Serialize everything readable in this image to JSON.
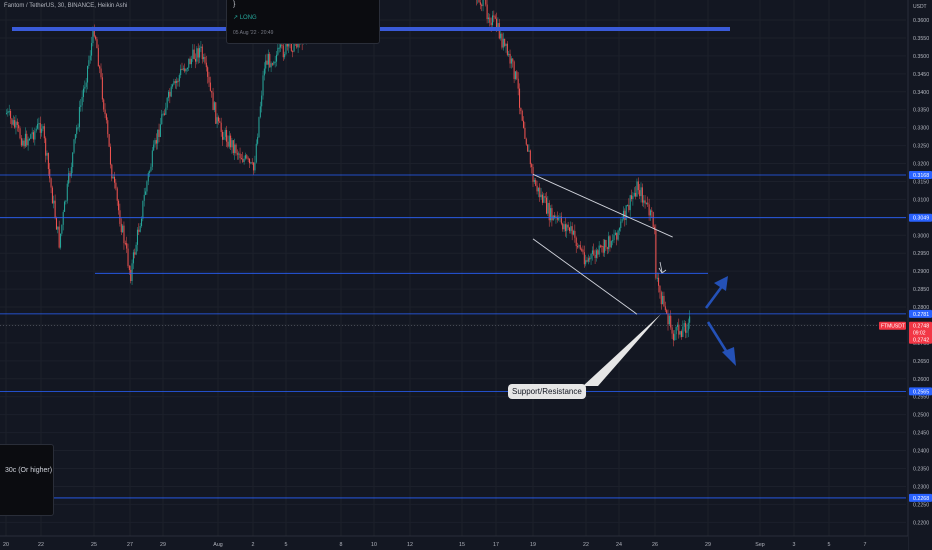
{
  "header": {
    "symbol_title": "Fantom / TetherUS, 30, BINANCE, Heikin Ashi"
  },
  "trade_popup": {
    "line1": "}",
    "line2": "↗ LONG",
    "line3": "05 Aug '22 · 20:49"
  },
  "side_note": {
    "text": "30c (Or higher)"
  },
  "callout": {
    "text": "Support/Resistance"
  },
  "price_axis": {
    "currency": "USDT",
    "ticks": [
      "0.3600",
      "0.3550",
      "0.3500",
      "0.3450",
      "0.3400",
      "0.3350",
      "0.3300",
      "0.3250",
      "0.3200",
      "0.3150",
      "0.3100",
      "0.3050",
      "0.3000",
      "0.2950",
      "0.2900",
      "0.2850",
      "0.2800",
      "0.2750",
      "0.2700",
      "0.2650",
      "0.2600",
      "0.2550",
      "0.2500",
      "0.2450",
      "0.2400",
      "0.2350",
      "0.2300",
      "0.2250",
      "0.2200"
    ]
  },
  "price_tags": [
    {
      "label": "0.3168",
      "color": "#2962ff"
    },
    {
      "label": "0.3049",
      "color": "#2962ff"
    },
    {
      "label": "0.2781",
      "color": "#2962ff"
    },
    {
      "label": "0.2565",
      "color": "#2962ff"
    },
    {
      "label": "0.2268",
      "color": "#2962ff"
    }
  ],
  "current_price": {
    "symbol": "FTMUSDT",
    "price": "0.2748",
    "countdown": "09:02",
    "open": "0.2742",
    "color": "#f23645"
  },
  "time_axis": {
    "labels": [
      "20",
      "22",
      "25",
      "27",
      "29",
      "Aug",
      "2",
      "5",
      "8",
      "10",
      "12",
      "15",
      "17",
      "19",
      "22",
      "24",
      "26",
      "29",
      "Sep",
      "3",
      "5",
      "7"
    ]
  },
  "colors": {
    "background": "#131722",
    "up": "#26a69a",
    "down": "#ef5350",
    "level_line": "#2962ff",
    "thick_level": "#3a5bd9",
    "arrow": "#2451b7",
    "trendline": "#d1d4dc"
  },
  "chart_data": {
    "type": "candlestick",
    "title": "Fantom / TetherUS, 30, BINANCE, Heikin Ashi",
    "xlabel": "",
    "ylabel": "",
    "ylim": [
      0.218,
      0.362
    ],
    "y_scale": "linear",
    "grid": true,
    "timeframe": "30m",
    "chart_style": "Heikin Ashi",
    "x_ticks": [
      "20",
      "22",
      "25",
      "27",
      "29",
      "Aug",
      "2",
      "5",
      "8",
      "10",
      "12",
      "15",
      "17",
      "19",
      "22",
      "24",
      "26",
      "29",
      "Sep",
      "3",
      "5",
      "7"
    ],
    "price_path": [
      {
        "date": "Jul 20",
        "price": 0.334
      },
      {
        "date": "Jul 21",
        "price": 0.326
      },
      {
        "date": "Jul 22",
        "price": 0.331
      },
      {
        "date": "Jul 23",
        "price": 0.298
      },
      {
        "date": "Jul 24",
        "price": 0.33
      },
      {
        "date": "Jul 25",
        "price": 0.358
      },
      {
        "date": "Jul 26",
        "price": 0.316
      },
      {
        "date": "Jul 27",
        "price": 0.289
      },
      {
        "date": "Jul 28",
        "price": 0.315
      },
      {
        "date": "Jul 29",
        "price": 0.335
      },
      {
        "date": "Jul 30",
        "price": 0.346
      },
      {
        "date": "Jul 31",
        "price": 0.352
      },
      {
        "date": "Aug 1",
        "price": 0.33
      },
      {
        "date": "Aug 2",
        "price": 0.318
      },
      {
        "date": "Aug 3",
        "price": 0.348
      },
      {
        "date": "Aug 5",
        "price": 0.352
      },
      {
        "date": "Aug 6",
        "price": 0.356
      },
      {
        "date": "Aug 8",
        "price": 0.362
      },
      {
        "date": "Aug 10",
        "price": 0.37
      },
      {
        "date": "Aug 12",
        "price": 0.375
      },
      {
        "date": "Aug 15",
        "price": 0.372
      },
      {
        "date": "Aug 16",
        "price": 0.366
      },
      {
        "date": "Aug 17",
        "price": 0.358
      },
      {
        "date": "Aug 18",
        "price": 0.345
      },
      {
        "date": "Aug 19",
        "price": 0.315
      },
      {
        "date": "Aug 20",
        "price": 0.305
      },
      {
        "date": "Aug 21",
        "price": 0.302
      },
      {
        "date": "Aug 22",
        "price": 0.293
      },
      {
        "date": "Aug 23",
        "price": 0.296
      },
      {
        "date": "Aug 24",
        "price": 0.302
      },
      {
        "date": "Aug 25",
        "price": 0.314
      },
      {
        "date": "Aug 26",
        "price": 0.302
      },
      {
        "date": "Aug 26",
        "price": 0.288
      },
      {
        "date": "Aug 27",
        "price": 0.272
      },
      {
        "date": "Aug 28",
        "price": 0.276
      }
    ],
    "horizontal_levels": [
      {
        "price": 0.3575,
        "style": "thick"
      },
      {
        "price": 0.3168,
        "style": "thin"
      },
      {
        "price": 0.3049,
        "style": "thin"
      },
      {
        "price": 0.2894,
        "style": "thin-partial"
      },
      {
        "price": 0.2781,
        "style": "thin"
      },
      {
        "price": 0.2565,
        "style": "thin"
      },
      {
        "price": 0.2268,
        "style": "thin"
      }
    ],
    "trendlines": [
      {
        "from": {
          "date": "Aug 19",
          "price": 0.317
        },
        "to": {
          "date": "Aug 27",
          "price": 0.2995
        }
      },
      {
        "from": {
          "date": "Aug 19",
          "price": 0.299
        },
        "to": {
          "date": "Aug 25",
          "price": 0.278
        }
      }
    ],
    "annotations": [
      {
        "text": "Support/Resistance",
        "anchor": {
          "date": "Aug 26",
          "price": 0.2781
        }
      },
      {
        "type": "arrow-up",
        "direction": "up",
        "anchor_date": "Aug 28"
      },
      {
        "type": "arrow-down",
        "direction": "down",
        "anchor_date": "Aug 28"
      }
    ],
    "last_price": 0.2748
  }
}
